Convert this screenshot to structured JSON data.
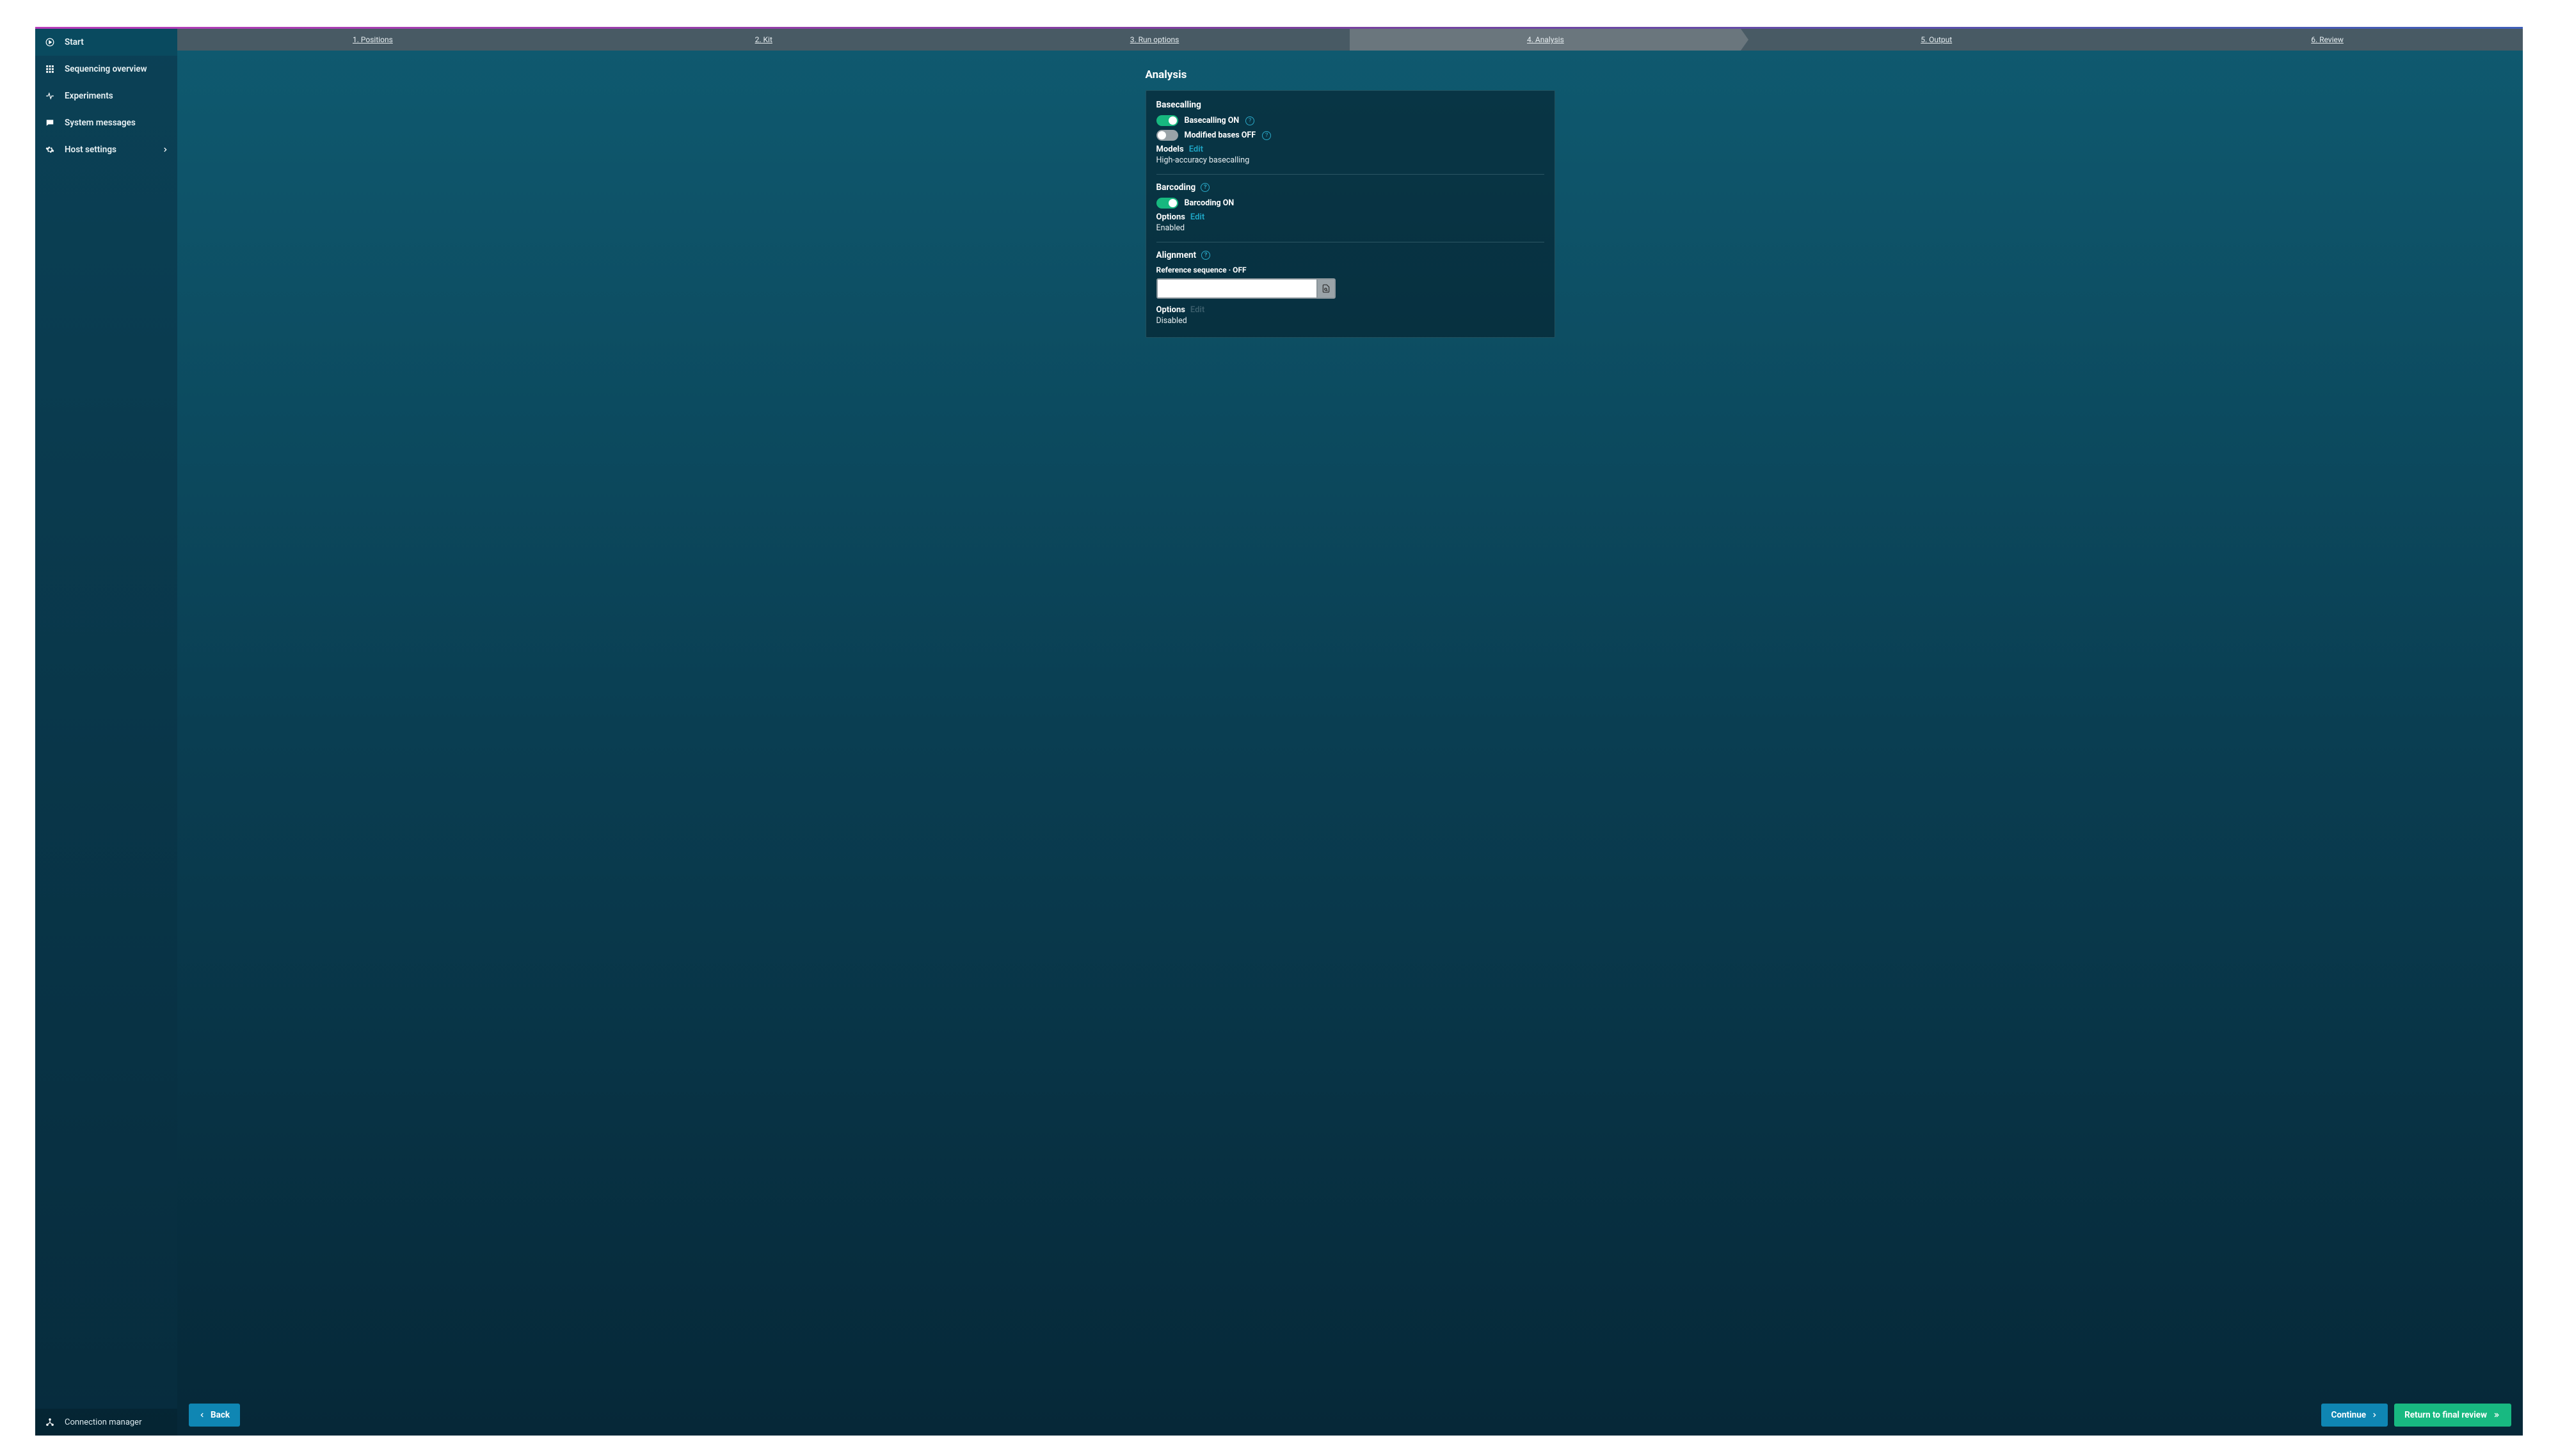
{
  "sidebar": {
    "items": [
      {
        "label": "Start",
        "icon": "play-circle-icon",
        "active": true
      },
      {
        "label": "Sequencing overview",
        "icon": "grid-icon"
      },
      {
        "label": "Experiments",
        "icon": "activity-icon"
      },
      {
        "label": "System messages",
        "icon": "message-icon"
      },
      {
        "label": "Host settings",
        "icon": "gear-icon",
        "chevron": true
      }
    ],
    "footer": {
      "label": "Connection manager",
      "icon": "hub-icon"
    }
  },
  "stepper": {
    "steps": [
      {
        "label": "1. Positions"
      },
      {
        "label": "2. Kit"
      },
      {
        "label": "3. Run options"
      },
      {
        "label": "4. Analysis",
        "active": true
      },
      {
        "label": "5. Output"
      },
      {
        "label": "6. Review"
      }
    ]
  },
  "page": {
    "title": "Analysis"
  },
  "basecalling": {
    "heading": "Basecalling",
    "toggle1_label": "Basecalling ON",
    "toggle1_state": "on",
    "toggle2_label": "Modified bases OFF",
    "toggle2_state": "off",
    "models_label": "Models",
    "models_edit": "Edit",
    "models_value": "High-accuracy basecalling"
  },
  "barcoding": {
    "heading": "Barcoding",
    "toggle_label": "Barcoding ON",
    "toggle_state": "on",
    "options_label": "Options",
    "options_edit": "Edit",
    "options_value": "Enabled"
  },
  "alignment": {
    "heading": "Alignment",
    "ref_label": "Reference sequence · OFF",
    "ref_value": "",
    "options_label": "Options",
    "options_edit": "Edit",
    "options_value": "Disabled"
  },
  "buttons": {
    "back": "Back",
    "continue": "Continue",
    "return_review": "Return to final review"
  },
  "colors": {
    "accent_blue": "#0f86b3",
    "accent_green": "#18b981",
    "link": "#1ea6c6"
  }
}
